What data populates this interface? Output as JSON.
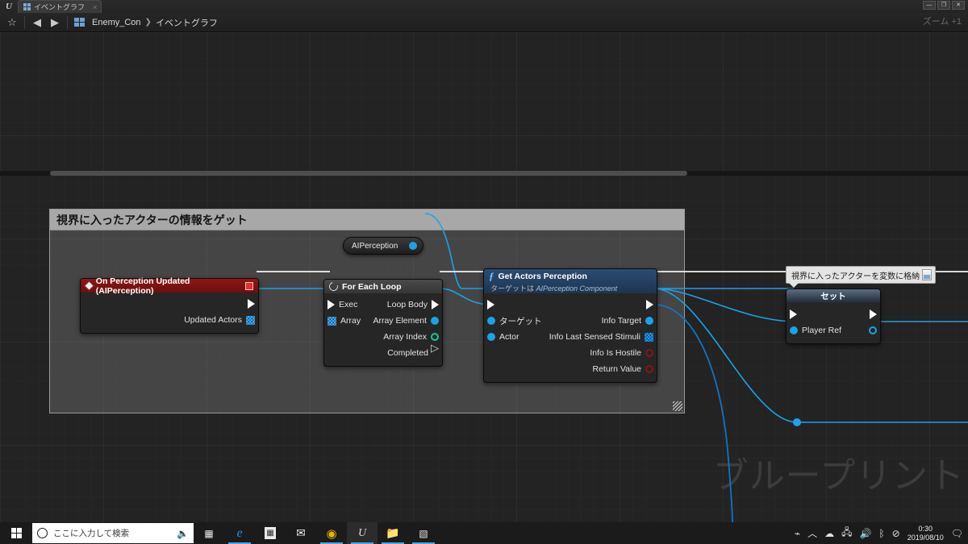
{
  "titlebar": {
    "logo": "ue-logo-icon",
    "tab_label": "イベントグラフ",
    "tab_close": "×",
    "minimize": "—",
    "maximize": "❐",
    "close": "✕"
  },
  "toolbar": {
    "favorite_icon": "☆",
    "back_icon": "◀",
    "forward_icon": "▶",
    "breadcrumb_root": "Enemy_Con",
    "breadcrumb_arrow": "❯",
    "breadcrumb_leaf": "イベントグラフ",
    "zoom_label": "ズーム +1"
  },
  "canvas": {
    "watermark": "ブループリント"
  },
  "comment": {
    "title": "視界に入ったアクターの情報をゲット"
  },
  "nodes": {
    "aiperception": {
      "label": "AIPerception"
    },
    "event": {
      "title": "On Perception Updated (AIPerception)",
      "out_exec": "",
      "out_actors": "Updated Actors"
    },
    "foreach": {
      "title": "For Each Loop",
      "in_exec": "Exec",
      "in_array": "Array",
      "out_loop_body": "Loop Body",
      "out_array_element": "Array Element",
      "out_array_index": "Array Index",
      "out_completed": "Completed"
    },
    "get_actors_perception": {
      "title": "Get Actors Perception",
      "subtitle_prefix": "ターゲットは",
      "subtitle_target": "AIPerception Component",
      "in_target": "ターゲット",
      "in_actor": "Actor",
      "out_info_target": "Info Target",
      "out_info_last_sensed": "Info Last Sensed Stimuli",
      "out_info_is_hostile": "Info Is Hostile",
      "out_return_value": "Return Value"
    },
    "set": {
      "title": "セット",
      "in_player_ref": "Player Ref",
      "bubble": "視界に入ったアクターを変数に格納"
    }
  },
  "colors": {
    "exec_wire": "#f2f2f2",
    "object_wire": "#1aa3e8",
    "array_wire": "#1373c4",
    "event_header": "#8e1616",
    "function_header": "#2c4c73",
    "bool_pin": "#8e1414",
    "int_pin": "#17c79a"
  },
  "taskbar": {
    "start_icon": "windows-icon",
    "search_placeholder": "ここに入力して検索",
    "mic_icon": "🎤",
    "apps": [
      {
        "name": "task-view",
        "glyph": "❐"
      },
      {
        "name": "edge",
        "glyph": "e"
      },
      {
        "name": "microsoft-store",
        "glyph": "▤"
      },
      {
        "name": "mail",
        "glyph": "✉"
      },
      {
        "name": "chrome",
        "glyph": "◉"
      },
      {
        "name": "unreal-engine",
        "glyph": "U"
      },
      {
        "name": "file-explorer",
        "glyph": "🗀"
      },
      {
        "name": "epic-games",
        "glyph": "E"
      }
    ],
    "tray": {
      "pen": "⌁",
      "chevron": "︿",
      "onedrive": "☁",
      "network": "🖧",
      "volume": "🔊",
      "bluetooth": "ᛒ",
      "shield": "⊘",
      "time": "0:30",
      "date": "2019/08/10",
      "action_center": "🗨"
    }
  }
}
